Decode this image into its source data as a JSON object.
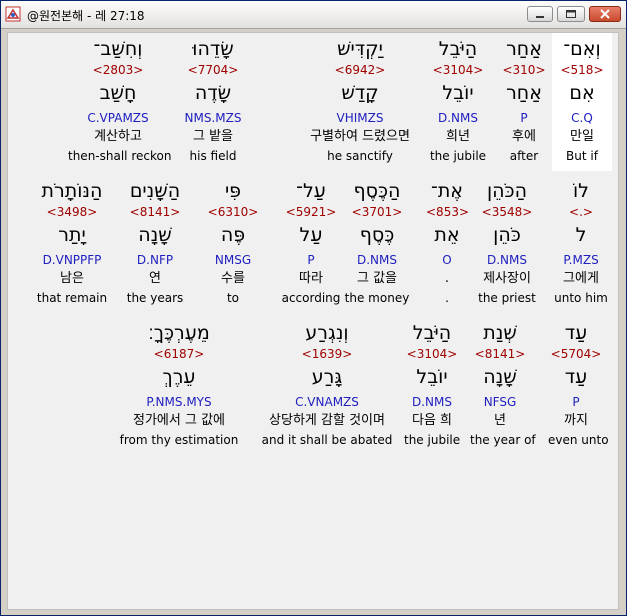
{
  "window": {
    "title": "@원전본해 - 레 27:18"
  },
  "rows": [
    {
      "words": [
        {
          "heb": "וְאִם־",
          "strong": "<518>",
          "lemma": "אִם",
          "morph": "C.Q",
          "kor": "만일",
          "eng": "But if",
          "hl": true
        },
        {
          "heb": "אַחַר",
          "strong": "<310>",
          "lemma": "אַחַר",
          "morph": "P",
          "kor": "후에",
          "eng": "after"
        },
        {
          "heb": "הַיֹּבֵל",
          "strong": "<3104>",
          "lemma": "יוֹבֵל",
          "morph": "D.NMS",
          "kor": "희년",
          "eng": "the jubile"
        },
        {
          "heb": "יַקְדִּישׁ",
          "strong": "<6942>",
          "lemma": "קָדַשׁ",
          "morph": "VHIMZS",
          "kor": "구별하여 드렸으면",
          "eng": "he sanctify"
        },
        {
          "heb": "שָׂדֵהוּ",
          "strong": "<7704>",
          "lemma": "שָׂדֶה",
          "morph": "NMS.MZS",
          "kor": "그 밭을",
          "eng": "his field"
        },
        {
          "heb": "וְחִשַּׁב־",
          "strong": "<2803>",
          "lemma": "חָשַׁב",
          "morph": "C.VPAMZS",
          "kor": "계산하고",
          "eng": "then-shall reckon"
        }
      ]
    },
    {
      "words": [
        {
          "heb": "לוֹ",
          "strong": "<.>",
          "lemma": "ל",
          "morph": "P.MZS",
          "kor": "그에게",
          "eng": "unto him"
        },
        {
          "heb": "הַכֹּהֵן",
          "strong": "<3548>",
          "lemma": "כֹּהֵן",
          "morph": "D.NMS",
          "kor": "제사장이",
          "eng": "the priest"
        },
        {
          "heb": "אֶת־",
          "strong": "<853>",
          "lemma": "אֵת",
          "morph": "O",
          "kor": ".",
          "eng": "."
        },
        {
          "heb": "הַכֶּסֶף",
          "strong": "<3701>",
          "lemma": "כֶּסֶף",
          "morph": "D.NMS",
          "kor": "그 값을",
          "eng": "the money"
        },
        {
          "heb": "עַל־",
          "strong": "<5921>",
          "lemma": "עַל",
          "morph": "P",
          "kor": "따라",
          "eng": "according"
        },
        {
          "heb": "פִּי",
          "strong": "<6310>",
          "lemma": "פֶּה",
          "morph": "NMSG",
          "kor": "수를",
          "eng": "to"
        },
        {
          "heb": "הַשָּׁנִים",
          "strong": "<8141>",
          "lemma": "שָׁנָה",
          "morph": "D.NFP",
          "kor": "연",
          "eng": "the years"
        },
        {
          "heb": "הַנּוֹתָרֹת",
          "strong": "<3498>",
          "lemma": "יָתַר",
          "morph": "D.VNPPFP",
          "kor": "남은",
          "eng": "that remain"
        }
      ]
    },
    {
      "words": [
        {
          "heb": "עַד",
          "strong": "<5704>",
          "lemma": "עַד",
          "morph": "P",
          "kor": "까지",
          "eng": "even unto"
        },
        {
          "heb": "שְׁנַת",
          "strong": "<8141>",
          "lemma": "שָׁנָה",
          "morph": "NFSG",
          "kor": "년",
          "eng": "the year of"
        },
        {
          "heb": "הַיֹּבֵל",
          "strong": "<3104>",
          "lemma": "יוֹבֵל",
          "morph": "D.NMS",
          "kor": "다음 희",
          "eng": "the jubile"
        },
        {
          "heb": "וְנִגְרַע",
          "strong": "<1639>",
          "lemma": "גָּרַע",
          "morph": "C.VNAMZS",
          "kor": "상당하게 감할 것이며",
          "eng": "and it shall be abated"
        },
        {
          "heb": "מֵעֶרְכֶּךָ׃",
          "strong": "<6187>",
          "lemma": "עֵרֶךְ",
          "morph": "P.NMS.MYS",
          "kor": "정가에서 그 값에",
          "eng": "from thy estimation"
        }
      ]
    }
  ]
}
